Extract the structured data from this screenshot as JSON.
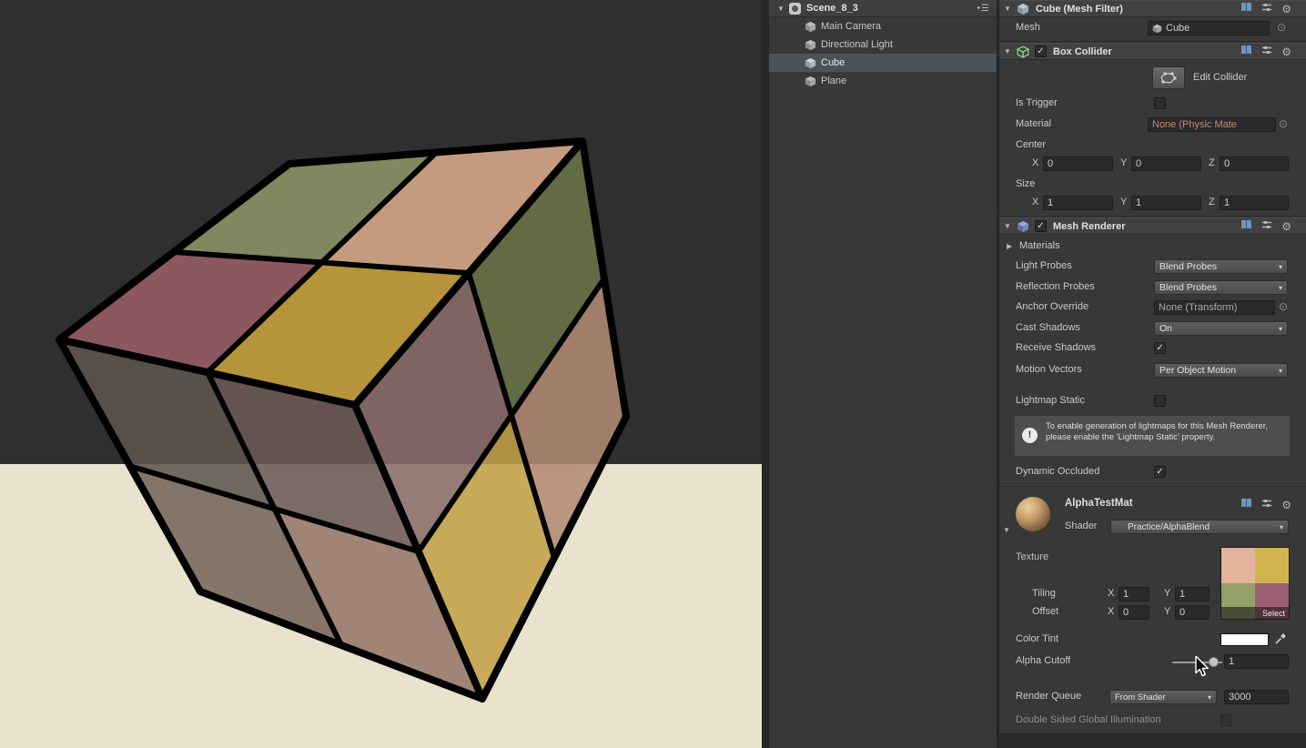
{
  "icons": {
    "fold_open": "▼",
    "fold_closed": "▶",
    "check": "✓",
    "dropdown_arrow": "▾",
    "picker": "⊙",
    "gear": "⚙",
    "menu": "☰",
    "info": "!"
  },
  "colors": {
    "panel_bg": "#383838",
    "field_bg": "#2a2a2a",
    "selection_row": "#4d5257",
    "scene_bg": "#2f2f2f",
    "floor": "#e9e2cc",
    "cube_edge": "#000000",
    "missing_ref_text": "#c5897a",
    "cube_faces": {
      "top_left_quad": "#9a5f68",
      "top_back_quad": "#8e9565",
      "top_right_quad": "#dcab8b",
      "top_front_quad": "#cba43c",
      "right_upper_left": "#8a6e6b",
      "right_upper_right": "#6a7548",
      "right_lower_right": "#b28a72",
      "right_lower_left": "#c3a148",
      "left_upper_left": "#5d5650",
      "left_upper_right": "#6d5a58",
      "left_lower_left": "#77655b",
      "left_lower_right": "#96786a"
    },
    "texture_swatches": [
      "#e3b39b",
      "#d2b44e",
      "#93a06a",
      "#9b5f72"
    ]
  },
  "hierarchy": {
    "scene_label": "Scene_8_3",
    "items": [
      {
        "label": "Main Camera",
        "selected": false
      },
      {
        "label": "Directional Light",
        "selected": false
      },
      {
        "label": "Cube",
        "selected": true
      },
      {
        "label": "Plane",
        "selected": false
      }
    ]
  },
  "inspector": {
    "axis": {
      "x": "X",
      "y": "Y",
      "z": "Z"
    },
    "mesh_filter": {
      "title": "Cube (Mesh Filter)",
      "mesh_label": "Mesh",
      "mesh_value": "Cube"
    },
    "box_collider": {
      "title": "Box Collider",
      "edit_collider_label": "Edit Collider",
      "is_trigger_label": "Is Trigger",
      "material_label": "Material",
      "material_value": "None (Physic Mate",
      "center_label": "Center",
      "size_label": "Size",
      "center": {
        "x": "0",
        "y": "0",
        "z": "0"
      },
      "size": {
        "x": "1",
        "y": "1",
        "z": "1"
      }
    },
    "mesh_renderer": {
      "title": "Mesh Renderer",
      "materials_label": "Materials",
      "light_probes_label": "Light Probes",
      "light_probes_value": "Blend Probes",
      "reflection_probes_label": "Reflection Probes",
      "reflection_probes_value": "Blend Probes",
      "anchor_override_label": "Anchor Override",
      "anchor_override_value": "None (Transform)",
      "cast_shadows_label": "Cast Shadows",
      "cast_shadows_value": "On",
      "receive_shadows_label": "Receive Shadows",
      "motion_vectors_label": "Motion Vectors",
      "motion_vectors_value": "Per Object Motion",
      "lightmap_static_label": "Lightmap Static",
      "info_text": "To enable generation of lightmaps for this Mesh Renderer, please enable the 'Lightmap Static' property.",
      "dynamic_occluded_label": "Dynamic Occluded"
    },
    "material": {
      "name": "AlphaTestMat",
      "shader_label": "Shader",
      "shader_value": "Practice/AlphaBlend",
      "texture_label": "Texture",
      "tiling_label": "Tiling",
      "offset_label": "Offset",
      "tiling": {
        "x": "1",
        "y": "1"
      },
      "offset": {
        "x": "0",
        "y": "0"
      },
      "select_label": "Select",
      "color_tint_label": "Color Tint",
      "alpha_cutoff_label": "Alpha Cutoff",
      "alpha_cutoff_value": "1",
      "render_queue_label": "Render Queue",
      "render_queue_mode": "From Shader",
      "render_queue_value": "3000",
      "dsgi_label": "Double Sided Global Illumination"
    }
  }
}
